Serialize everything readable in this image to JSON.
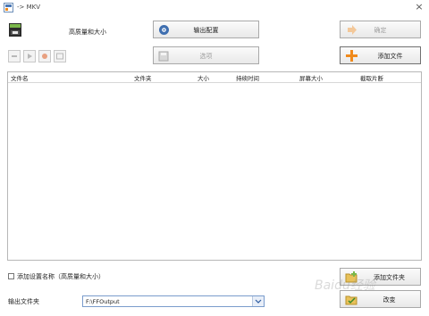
{
  "window": {
    "title": "-> MKV",
    "close_glyph": "×"
  },
  "profile": {
    "label": "高质量和大小",
    "icon": "mkv-file-icon"
  },
  "buttons": {
    "output_config": "输出配置",
    "confirm": "确定",
    "options": "选项",
    "add_file": "添加文件",
    "add_folder": "添加文件夹",
    "change": "改变"
  },
  "toolbar": {
    "icons": [
      "remove-item-icon",
      "play-icon",
      "stop-icon",
      "info-icon"
    ]
  },
  "table": {
    "columns": [
      "文件名",
      "文件夹",
      "大小",
      "持续时间",
      "屏幕大小",
      "截取片断"
    ],
    "rows": []
  },
  "checkbox": {
    "label": "添加设置名称（高质量和大小）",
    "checked": false
  },
  "output_folder": {
    "label": "输出文件夹",
    "value": "F:\\FFOutput"
  },
  "watermark": "Baidu经验",
  "colors": {
    "accent_orange": "#f08a1c",
    "field_border": "#7a9ccc"
  }
}
